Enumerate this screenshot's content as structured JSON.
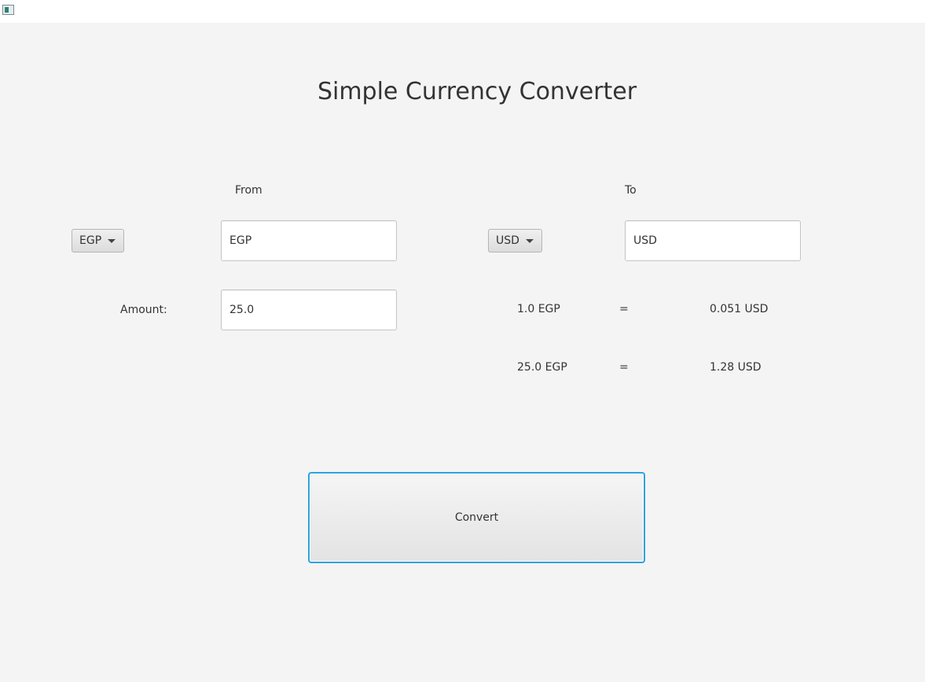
{
  "window": {
    "icon": "app-window-icon"
  },
  "title": "Simple Currency Converter",
  "from": {
    "heading": "From",
    "selected_currency": "EGP",
    "currency_field_value": "EGP"
  },
  "to": {
    "heading": "To",
    "selected_currency": "USD",
    "currency_field_value": "USD"
  },
  "amount": {
    "label": "Amount:",
    "value": "25.0"
  },
  "rates": [
    {
      "left": "1.0 EGP",
      "equals": "=",
      "right": "0.051 USD"
    },
    {
      "left": "25.0 EGP",
      "equals": "=",
      "right": "1.28 USD"
    }
  ],
  "convert_button": {
    "label": "Convert"
  },
  "colors": {
    "background": "#f4f4f4",
    "focus_accent": "#2aa3e0",
    "text": "#333333"
  }
}
